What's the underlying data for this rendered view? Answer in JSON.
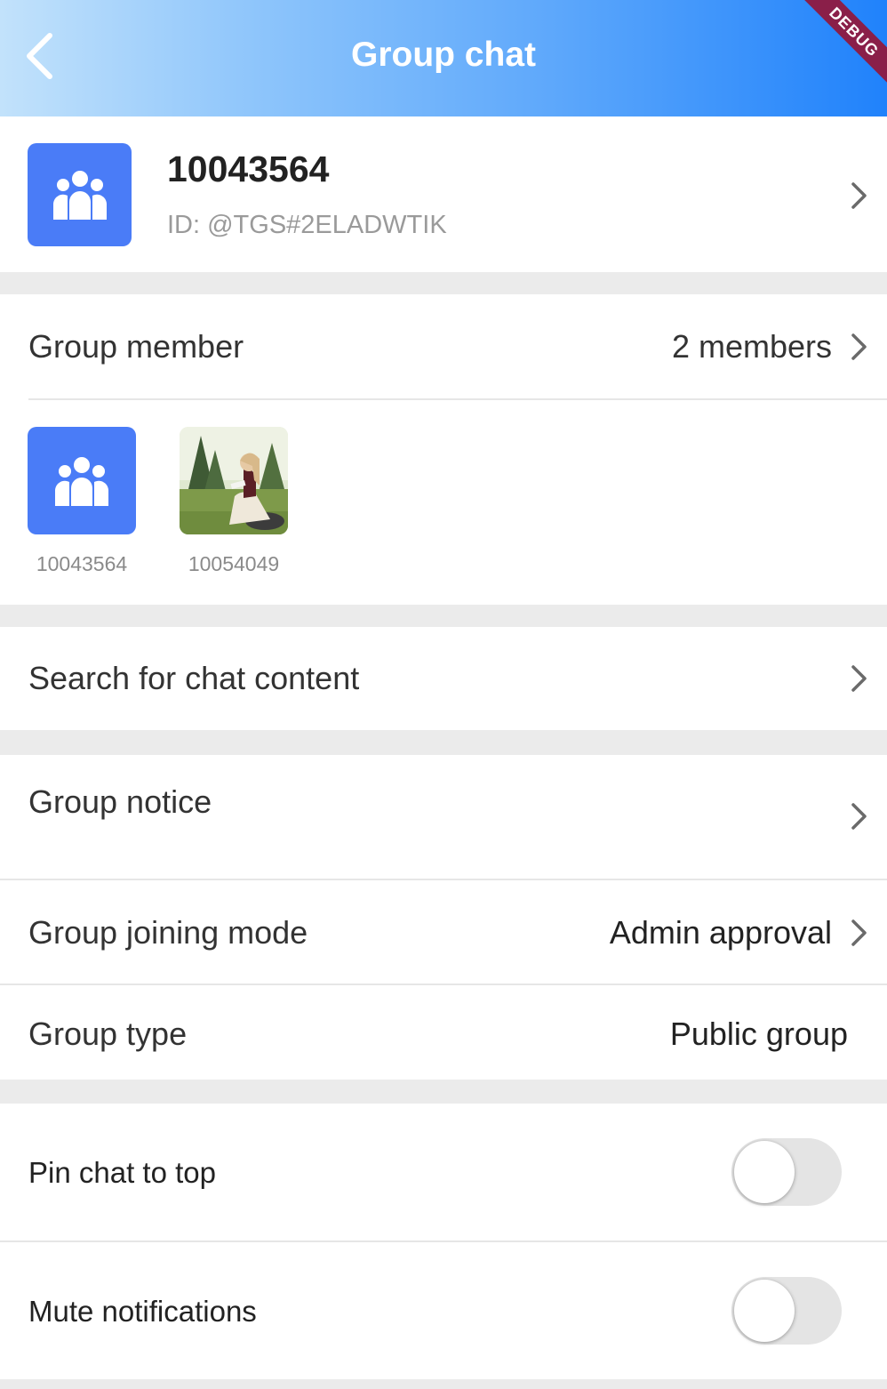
{
  "header": {
    "title": "Group chat",
    "back_icon": "chevron-left-icon",
    "debug_banner": "DEBUG"
  },
  "group": {
    "name": "10043564",
    "id_text": "ID: @TGS#2ELADWTIK",
    "avatar_icon": "group-icon",
    "accent_color": "#4a7cf7"
  },
  "members": {
    "label": "Group member",
    "count_text": "2 members",
    "list": [
      {
        "name": "10043564",
        "avatar": "group-icon"
      },
      {
        "name": "10054049",
        "avatar": "photo-avatar"
      }
    ]
  },
  "search": {
    "label": "Search for chat content"
  },
  "notice": {
    "label": "Group notice"
  },
  "joining": {
    "label": "Group joining mode",
    "value": "Admin approval"
  },
  "type": {
    "label": "Group type",
    "value": "Public group"
  },
  "pin": {
    "label": "Pin chat to top",
    "on": false
  },
  "mute": {
    "label": "Mute notifications",
    "on": false
  }
}
